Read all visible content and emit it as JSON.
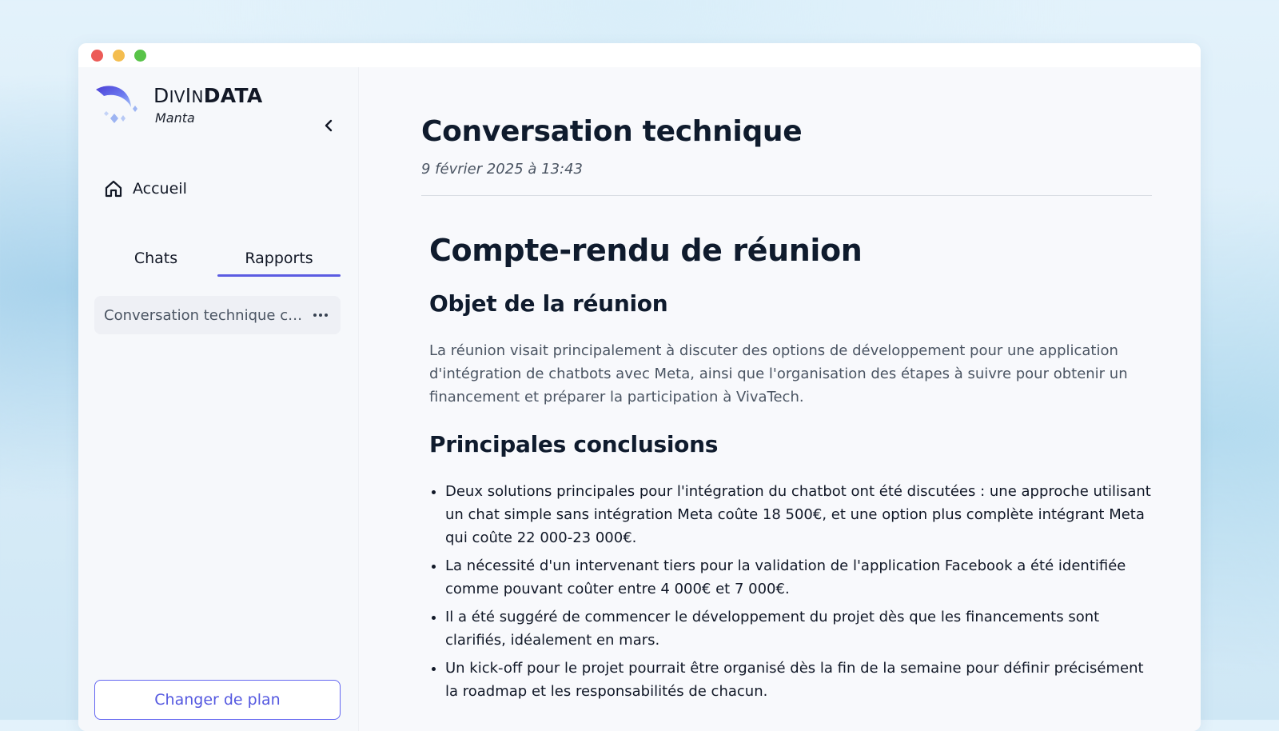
{
  "brand": {
    "name_first": "D",
    "name_small": "IV",
    "name_mid": "I",
    "name_small2": "N",
    "name_bold": "DATA",
    "subtitle": "Manta"
  },
  "sidebar": {
    "home_label": "Accueil",
    "tabs": [
      {
        "label": "Chats",
        "active": false
      },
      {
        "label": "Rapports",
        "active": true
      }
    ],
    "reports": [
      {
        "title": "Conversation technique co..."
      }
    ],
    "plan_button": "Changer de plan"
  },
  "main": {
    "title": "Conversation technique",
    "date": "9 février 2025 à 13:43",
    "doc": {
      "h1": "Compte-rendu de réunion",
      "section1_title": "Objet de la réunion",
      "section1_text": "La réunion visait principalement à discuter des options de développement pour une application d'intégration de chatbots avec Meta, ainsi que l'organisation des étapes à suivre pour obtenir un financement et préparer la participation à VivaTech.",
      "section2_title": "Principales conclusions",
      "bullets": [
        "Deux solutions principales pour l'intégration du chatbot ont été discutées : une approche utilisant un chat simple sans intégration Meta coûte 18 500€, et une option plus complète intégrant Meta qui coûte 22 000-23 000€.",
        "La nécessité d'un intervenant tiers pour la validation de l'application Facebook a été identifiée comme pouvant coûter entre 4 000€ et 7 000€.",
        "Il a été suggéré de commencer le développement du projet dès que les financements sont clarifiés, idéalement en mars.",
        "Un kick-off pour le projet pourrait être organisé dès la fin de la semaine pour définir précisément la roadmap et les responsabilités de chacun."
      ]
    }
  },
  "colors": {
    "accent": "#5b5ce2",
    "title_text": "#0f1b2d",
    "body_text": "#4b5563"
  }
}
